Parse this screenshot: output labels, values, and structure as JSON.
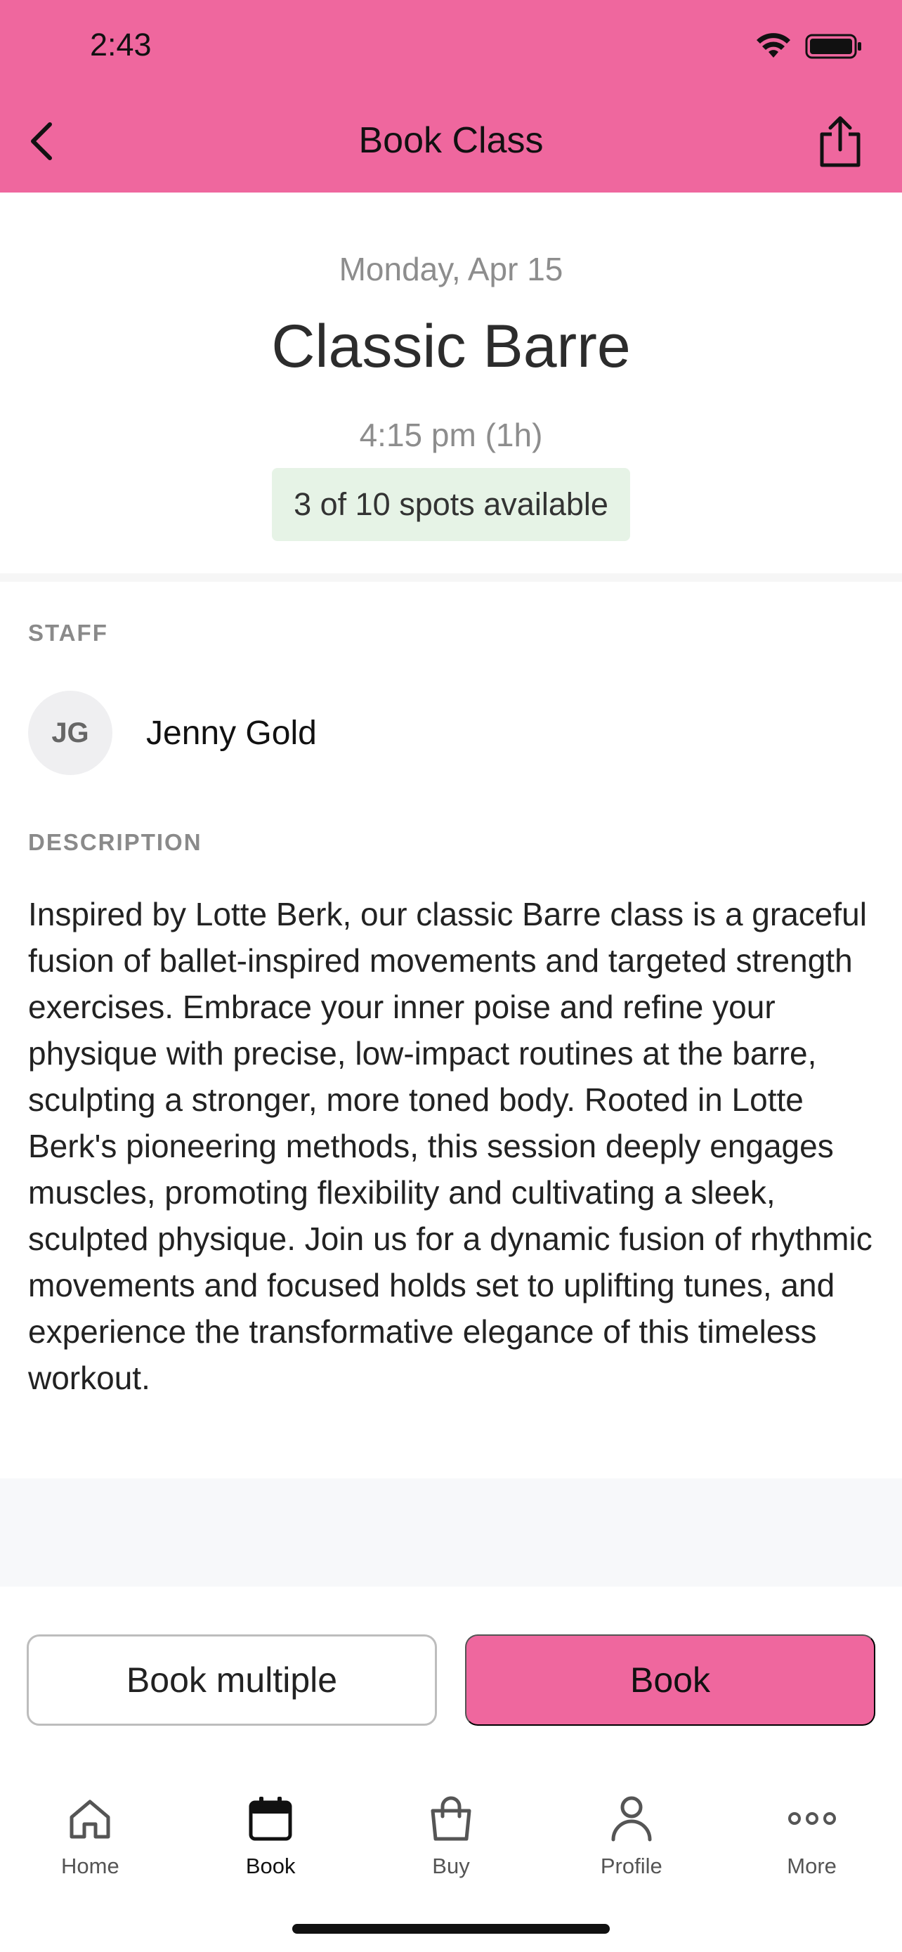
{
  "status_bar": {
    "time": "2:43",
    "icons": [
      "wifi-icon",
      "battery-icon"
    ]
  },
  "header": {
    "title": "Book Class",
    "back_icon": "chevron-left-icon",
    "share_icon": "share-icon"
  },
  "class_info": {
    "date": "Monday, Apr 15",
    "title": "Classic Barre",
    "time": "4:15 pm (1h)",
    "spots": "3 of 10 spots available"
  },
  "staff": {
    "label": "STAFF",
    "initials": "JG",
    "name": "Jenny Gold"
  },
  "description": {
    "label": "DESCRIPTION",
    "text": "Inspired by Lotte Berk, our classic Barre class is a graceful fusion of ballet-inspired movements and targeted strength exercises. Embrace your inner poise and refine your physique with precise, low-impact routines at the barre, sculpting a stronger, more toned body. Rooted in Lotte Berk's pioneering methods, this session deeply engages muscles, promoting flexibility and cultivating a sleek, sculpted physique. Join us for a dynamic fusion of rhythmic movements and focused holds set to uplifting tunes, and experience the transformative elegance of this timeless workout."
  },
  "actions": {
    "book_multiple": "Book multiple",
    "book": "Book"
  },
  "tabs": [
    {
      "label": "Home",
      "icon": "home-icon",
      "active": false
    },
    {
      "label": "Book",
      "icon": "calendar-icon",
      "active": true
    },
    {
      "label": "Buy",
      "icon": "shopping-bag-icon",
      "active": false
    },
    {
      "label": "Profile",
      "icon": "person-icon",
      "active": false
    },
    {
      "label": "More",
      "icon": "more-dots-icon",
      "active": false
    }
  ],
  "colors": {
    "brand": "#ef679e",
    "spots_bg": "#e6f3e6",
    "muted_text": "#8d8d8d"
  }
}
